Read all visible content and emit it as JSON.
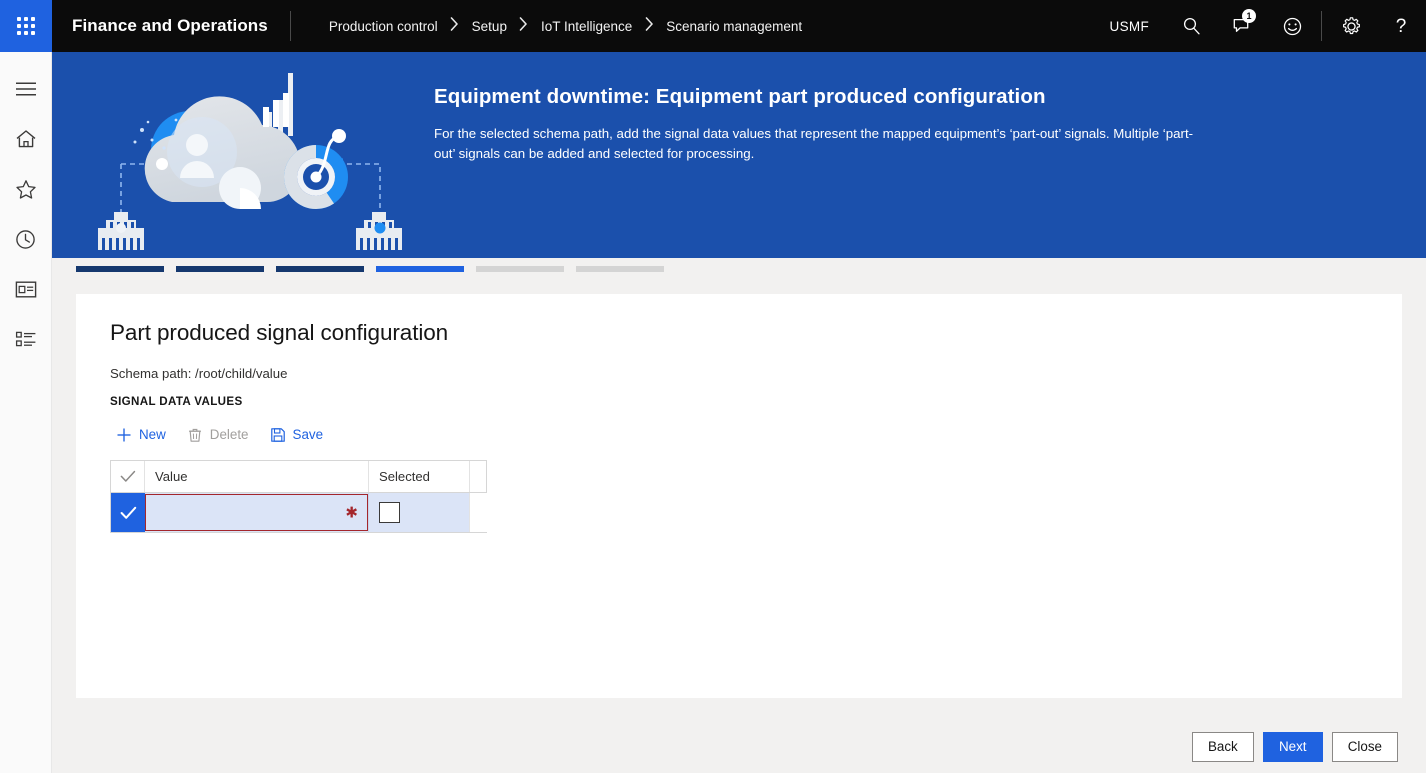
{
  "topbar": {
    "app_launcher_icon": "grid-dots-icon",
    "brand": "Finance and Operations",
    "breadcrumb": [
      "Production control",
      "Setup",
      "IoT Intelligence",
      "Scenario management"
    ],
    "breadcrumb_separator": "›",
    "company": "USMF",
    "icons": [
      {
        "name": "search-icon",
        "label": "Search"
      },
      {
        "name": "notifications-icon",
        "label": "Notifications",
        "badge": "1"
      },
      {
        "name": "feedback-smiley-icon",
        "label": "Feedback"
      },
      {
        "name": "settings-gear-icon",
        "label": "Settings"
      },
      {
        "name": "help-question-icon",
        "label": "Help"
      }
    ]
  },
  "rail": {
    "items": [
      {
        "name": "hamburger-menu-icon",
        "label": "Expand navigation"
      },
      {
        "name": "home-icon",
        "label": "Home"
      },
      {
        "name": "favorites-star-icon",
        "label": "Favorites"
      },
      {
        "name": "recent-clock-icon",
        "label": "Recent"
      },
      {
        "name": "workspaces-icon",
        "label": "Workspaces"
      },
      {
        "name": "modules-list-icon",
        "label": "Modules"
      }
    ]
  },
  "hero": {
    "title": "Equipment downtime: Equipment part produced configuration",
    "description": "For the selected schema path, add the signal data values that represent the mapped equipment’s ‘part-out’ signals. Multiple ‘part-out’ signals can be added and selected for processing.",
    "background_color": "#1B50AC",
    "illustration": "iot-cloud-analytics-illustration"
  },
  "steps": {
    "total": 6,
    "current_index": 4,
    "states": [
      "done",
      "done",
      "done",
      "current",
      "upcoming",
      "upcoming"
    ],
    "colors": {
      "done": "#15386E",
      "current": "#1F62E0",
      "upcoming": "#D4D4D4"
    }
  },
  "card": {
    "title": "Part produced signal configuration",
    "schema_path": "Schema path: /root/child/value",
    "section_label": "SIGNAL DATA VALUES",
    "toolbar": [
      {
        "name": "new-button",
        "label": "New",
        "icon": "plus-icon",
        "disabled": false
      },
      {
        "name": "delete-button",
        "label": "Delete",
        "icon": "trash-icon",
        "disabled": true
      },
      {
        "name": "save-button",
        "label": "Save",
        "icon": "save-floppy-icon",
        "disabled": false
      }
    ],
    "grid": {
      "header_check_icon": "checkmark-icon",
      "columns": [
        "Value",
        "Selected"
      ],
      "rows": [
        {
          "selected": true,
          "row_check_icon": "checkmark-icon",
          "value": "",
          "value_placeholder": "",
          "value_required": true,
          "required_marker": "✱",
          "selected_checkbox": false
        }
      ]
    }
  },
  "footer": {
    "buttons": [
      {
        "name": "back-button",
        "label": "Back",
        "primary": false
      },
      {
        "name": "next-button",
        "label": "Next",
        "primary": true
      },
      {
        "name": "close-button",
        "label": "Close",
        "primary": false
      }
    ]
  }
}
